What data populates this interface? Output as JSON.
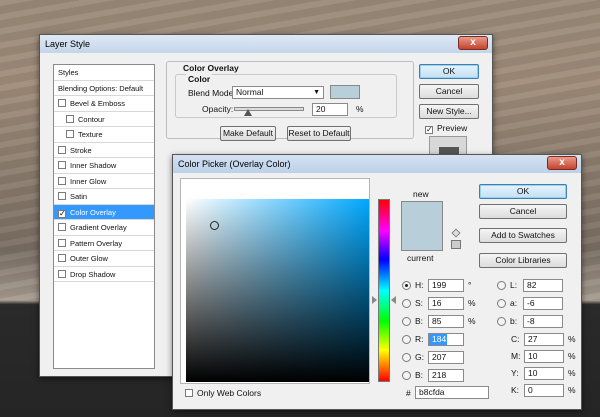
{
  "layer_style": {
    "title": "Layer Style",
    "close": "x",
    "styles_items": [
      {
        "label": "Styles",
        "checkbox": false,
        "checked": false
      },
      {
        "label": "Blending Options: Default",
        "checkbox": false,
        "checked": false
      },
      {
        "label": "Bevel & Emboss",
        "checkbox": true,
        "checked": false
      },
      {
        "label": "Contour",
        "checkbox": true,
        "checked": false,
        "indent": true
      },
      {
        "label": "Texture",
        "checkbox": true,
        "checked": false,
        "indent": true
      },
      {
        "label": "Stroke",
        "checkbox": true,
        "checked": false
      },
      {
        "label": "Inner Shadow",
        "checkbox": true,
        "checked": false
      },
      {
        "label": "Inner Glow",
        "checkbox": true,
        "checked": false
      },
      {
        "label": "Satin",
        "checkbox": true,
        "checked": false
      },
      {
        "label": "Color Overlay",
        "checkbox": true,
        "checked": true,
        "selected": true
      },
      {
        "label": "Gradient Overlay",
        "checkbox": true,
        "checked": false
      },
      {
        "label": "Pattern Overlay",
        "checkbox": true,
        "checked": false
      },
      {
        "label": "Outer Glow",
        "checkbox": true,
        "checked": false
      },
      {
        "label": "Drop Shadow",
        "checkbox": true,
        "checked": false
      }
    ],
    "section_title": "Color Overlay",
    "group_title": "Color",
    "blend_mode_label": "Blend Mode:",
    "blend_mode_value": "Normal",
    "opacity_label": "Opacity:",
    "opacity_value": "20",
    "opacity_unit": "%",
    "opacity_level": 0.2,
    "make_default": "Make Default",
    "reset_default": "Reset to Default",
    "ok": "OK",
    "cancel": "Cancel",
    "new_style": "New Style...",
    "preview_label": "Preview",
    "preview_checked": true,
    "overlay_color": "#b8cfda"
  },
  "color_picker": {
    "title": "Color Picker (Overlay Color)",
    "close": "x",
    "ok": "OK",
    "cancel": "Cancel",
    "add_swatches": "Add to Swatches",
    "color_libraries": "Color Libraries",
    "new_label": "new",
    "current_label": "current",
    "only_web_colors": "Only Web Colors",
    "hsb": [
      {
        "label": "H:",
        "value": "199",
        "unit": "°",
        "selected": true
      },
      {
        "label": "S:",
        "value": "16",
        "unit": "%",
        "selected": false
      },
      {
        "label": "B:",
        "value": "85",
        "unit": "%",
        "selected": false
      }
    ],
    "rgb": [
      {
        "label": "R:",
        "value": "184",
        "highlight": true
      },
      {
        "label": "G:",
        "value": "207"
      },
      {
        "label": "B:",
        "value": "218"
      }
    ],
    "lab": [
      {
        "label": "L:",
        "value": "82"
      },
      {
        "label": "a:",
        "value": "-6"
      },
      {
        "label": "b:",
        "value": "-8"
      }
    ],
    "cmyk": [
      {
        "label": "C:",
        "value": "27",
        "unit": "%"
      },
      {
        "label": "M:",
        "value": "10",
        "unit": "%"
      },
      {
        "label": "Y:",
        "value": "10",
        "unit": "%"
      },
      {
        "label": "K:",
        "value": "0",
        "unit": "%"
      }
    ],
    "hex_label": "#",
    "hex_value": "b8cfda",
    "field_hue_color": "#00a8ff",
    "current_color": "#b8cfda",
    "hue_fraction": 0.553,
    "marker_saturation": 0.16,
    "marker_brightness": 0.85
  }
}
